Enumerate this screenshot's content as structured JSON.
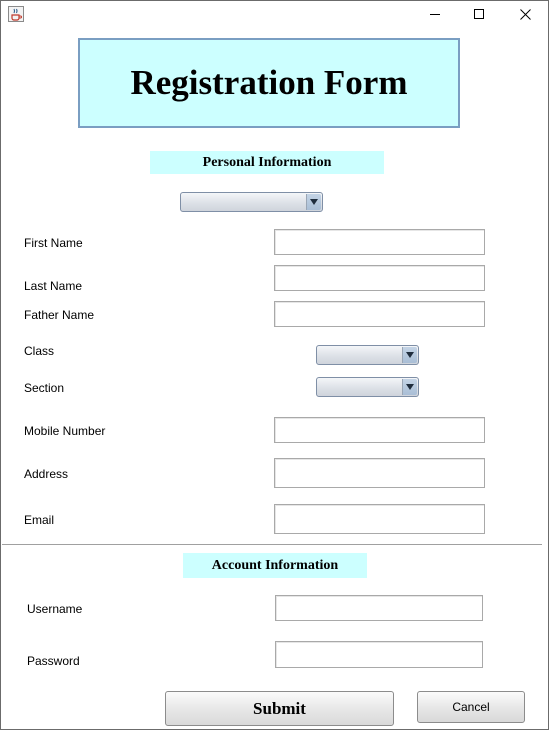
{
  "window": {
    "app_icon": "java-cup-icon",
    "controls": [
      "minimize-icon",
      "maximize-icon",
      "close-icon"
    ]
  },
  "header": {
    "title": "Registration Form"
  },
  "personal": {
    "heading": "Personal Information",
    "type_select": {
      "value": ""
    },
    "first_name": {
      "label": "First Name",
      "value": ""
    },
    "last_name": {
      "label": "Last Name",
      "value": ""
    },
    "father_name": {
      "label": "Father Name",
      "value": ""
    },
    "class": {
      "label": "Class",
      "value": ""
    },
    "section": {
      "label": "Section",
      "value": ""
    },
    "mobile": {
      "label": "Mobile Number",
      "value": ""
    },
    "address": {
      "label": "Address",
      "value": ""
    },
    "email": {
      "label": "Email",
      "value": ""
    }
  },
  "account": {
    "heading": "Account Information",
    "username": {
      "label": "Username",
      "value": ""
    },
    "password": {
      "label": "Password",
      "value": ""
    }
  },
  "actions": {
    "submit_label": "Submit",
    "cancel_label": "Cancel"
  },
  "colors": {
    "title_bg": "#ccffff",
    "title_border": "#7a9ec2",
    "section_bg": "#ccffff"
  }
}
